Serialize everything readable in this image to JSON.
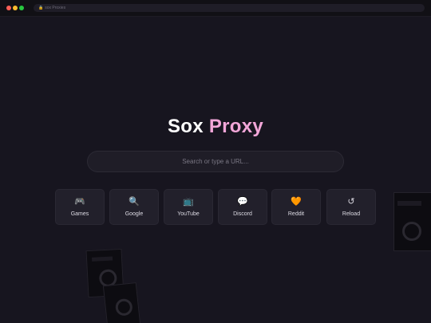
{
  "browser": {
    "url": "sox Proxies"
  },
  "title": {
    "part1": "Sox",
    "part2": "Proxy"
  },
  "search": {
    "placeholder": "Search or type a URL..."
  },
  "shortcuts": [
    {
      "label": "Games",
      "icon": "🎮",
      "icon_name": "gamepad-icon"
    },
    {
      "label": "Google",
      "icon": "🔍",
      "icon_name": "magnifier-icon"
    },
    {
      "label": "YouTube",
      "icon": "📺",
      "icon_name": "television-icon"
    },
    {
      "label": "Discord",
      "icon": "💬",
      "icon_name": "speech-bubble-icon"
    },
    {
      "label": "Reddit",
      "icon": "🧡",
      "icon_name": "orange-heart-icon"
    },
    {
      "label": "Reload",
      "icon": "↺",
      "icon_name": "reload-icon"
    }
  ],
  "colors": {
    "background": "#17151f",
    "title_accent": "#f2a6d8",
    "tile": "#22202b"
  }
}
